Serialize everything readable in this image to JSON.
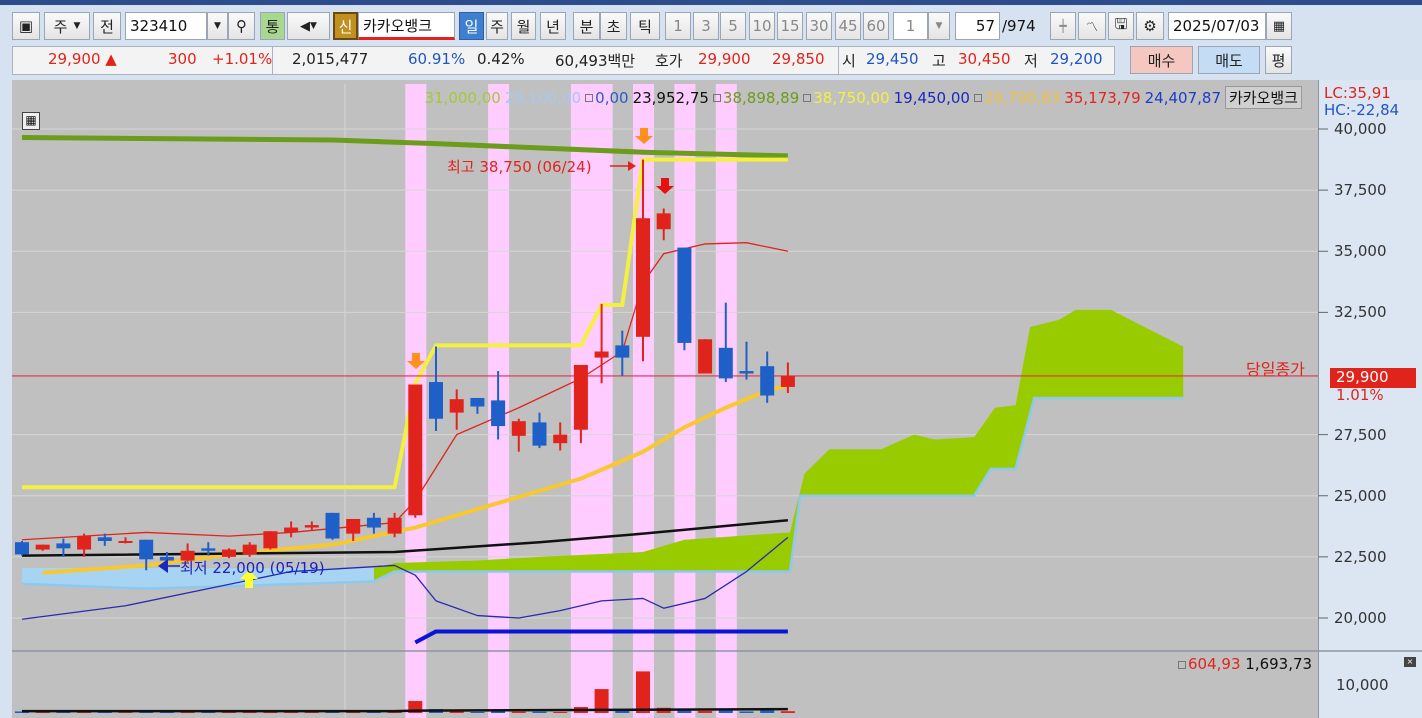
{
  "toolbar": {
    "market_label": "주",
    "prev_label": "전",
    "code": "323410",
    "comm_label": "통",
    "credit_label": "신",
    "stock_name": "카카오뱅크",
    "periods": [
      "일",
      "주",
      "월",
      "년",
      "분",
      "초",
      "틱"
    ],
    "selected_period": "일",
    "intervals": [
      "1",
      "3",
      "5",
      "10",
      "15",
      "30",
      "45",
      "60"
    ],
    "unit_value": "1",
    "count_value": "57",
    "count_total": "/974",
    "date": "2025/07/03"
  },
  "quote": {
    "price": "29,900",
    "change_arrow": "▲",
    "change": "300",
    "change_pct": "+1.01%",
    "volume": "2,015,477",
    "ratio1": "60.91%",
    "ratio2": "0.42%",
    "amount": "60,493백만",
    "hoga_label": "호가",
    "ask": "29,900",
    "bid": "29,850",
    "open_label": "시",
    "open": "29,450",
    "high_label": "고",
    "high": "30,450",
    "low_label": "저",
    "low": "29,200",
    "buy_label": "매수",
    "sell_label": "매도",
    "eval_label": "평"
  },
  "legend": {
    "items": [
      {
        "text": "31,000,00",
        "color": "#a4c83c",
        "box": false
      },
      {
        "text": "29,100,00",
        "color": "#a8c8ec",
        "box": false
      },
      {
        "text": "0,00",
        "color": "#2a5ad0",
        "box": true
      },
      {
        "text": "23,952,75",
        "color": "#111111",
        "box": false
      },
      {
        "text": "38,898,89",
        "color": "#6c9c1c",
        "box": true
      },
      {
        "text": "38,750,00",
        "color": "#f4f040",
        "box": true
      },
      {
        "text": "19,450,00",
        "color": "#1a28c0",
        "box": false
      },
      {
        "text": "29,790,83",
        "color": "#f0c040",
        "box": true
      },
      {
        "text": "35,173,79",
        "color": "#e0241c",
        "box": false
      },
      {
        "text": "24,407,87",
        "color": "#1a3cc8",
        "box": false
      }
    ],
    "stock_name": "카카오뱅크",
    "lc": "LC:35,91",
    "hc": "HC:-22,84"
  },
  "axis": {
    "ticks": [
      "40,000",
      "37,500",
      "35,000",
      "32,500",
      "27,500",
      "25,000",
      "22,500",
      "20,000"
    ],
    "tick_values": [
      40000,
      37500,
      35000,
      32500,
      27500,
      25000,
      22500,
      20000
    ],
    "close_label": "당일종가",
    "close_price": "29,900",
    "close_value": 29900,
    "close_pct": "1.01%",
    "volume_tick": "10,000",
    "volume_tick_value": 10000
  },
  "annotations": {
    "high": "최고 38,750 (06/24)",
    "low": "최저 22,000 (05/19)"
  },
  "volume_legend": {
    "v1": "604,93",
    "v2": "1,693,73"
  },
  "colors": {
    "up": "#e0241c",
    "down": "#1f5fc8",
    "highlight": "#ffccff"
  },
  "chart_data": {
    "type": "candlestick",
    "ylim": [
      19000,
      41000
    ],
    "highlight_indices": [
      19,
      23,
      27,
      28,
      30,
      32,
      34
    ],
    "candles": [
      [
        23100,
        23150,
        22550,
        22600
      ],
      [
        22800,
        23000,
        22750,
        23000
      ],
      [
        23050,
        23250,
        22500,
        22850
      ],
      [
        22800,
        23450,
        22500,
        23350
      ],
      [
        23300,
        23450,
        22950,
        23150
      ],
      [
        23100,
        23300,
        23050,
        23150
      ],
      [
        23200,
        23200,
        21950,
        22400
      ],
      [
        22500,
        22700,
        22050,
        22350
      ],
      [
        22350,
        23050,
        22300,
        22750
      ],
      [
        22850,
        23100,
        22550,
        22750
      ],
      [
        22500,
        22850,
        22450,
        22800
      ],
      [
        22600,
        23100,
        22500,
        23000
      ],
      [
        22850,
        23550,
        22800,
        23550
      ],
      [
        23500,
        23950,
        23300,
        23700
      ],
      [
        23700,
        23950,
        23600,
        23800
      ],
      [
        24300,
        24300,
        23200,
        23250
      ],
      [
        23450,
        24050,
        23150,
        24050
      ],
      [
        24100,
        24300,
        23450,
        23700
      ],
      [
        23450,
        24300,
        23300,
        24100
      ],
      [
        24200,
        29550,
        24100,
        29550
      ],
      [
        29650,
        31100,
        27650,
        28150
      ],
      [
        28400,
        29350,
        27700,
        28950
      ],
      [
        29000,
        29000,
        28350,
        28650
      ],
      [
        28900,
        30100,
        27300,
        27850
      ],
      [
        27450,
        28150,
        26800,
        28050
      ],
      [
        28000,
        28400,
        26950,
        27050
      ],
      [
        27150,
        28000,
        26850,
        27500
      ],
      [
        27700,
        30350,
        27150,
        30350
      ],
      [
        30650,
        32850,
        29600,
        30900
      ],
      [
        31150,
        31750,
        29900,
        30650
      ],
      [
        31500,
        38750,
        30500,
        36350
      ],
      [
        35900,
        36750,
        35450,
        36550
      ],
      [
        35150,
        35150,
        30950,
        31250
      ],
      [
        30000,
        31400,
        30000,
        31400
      ],
      [
        31050,
        32900,
        29650,
        29800
      ],
      [
        30100,
        31300,
        29750,
        30000
      ],
      [
        30300,
        30900,
        28800,
        29100
      ],
      [
        29450,
        30450,
        29200,
        29900
      ]
    ],
    "lines": [
      {
        "name": "envelope-top",
        "color": "#6c9c1c",
        "width": 5,
        "points": [
          [
            0,
            39650
          ],
          [
            15,
            39550
          ],
          [
            20,
            39400
          ],
          [
            30,
            39050
          ],
          [
            37,
            38900
          ]
        ]
      },
      {
        "name": "price-channel",
        "color": "#f4f040",
        "width": 4,
        "points": [
          [
            0,
            25350
          ],
          [
            18,
            25350
          ],
          [
            19,
            29600
          ],
          [
            20,
            31150
          ],
          [
            27,
            31150
          ],
          [
            28,
            32800
          ],
          [
            29,
            32800
          ],
          [
            30,
            38750
          ],
          [
            37,
            38750
          ]
        ]
      },
      {
        "name": "ma-long",
        "color": "#f8c830",
        "width": 4,
        "points": [
          [
            1,
            21850
          ],
          [
            6,
            22150
          ],
          [
            10,
            22600
          ],
          [
            15,
            23000
          ],
          [
            19,
            23700
          ],
          [
            23,
            24700
          ],
          [
            27,
            25700
          ],
          [
            30,
            26800
          ],
          [
            32,
            27800
          ],
          [
            34,
            28600
          ],
          [
            36,
            29300
          ],
          [
            37,
            29500
          ]
        ]
      },
      {
        "name": "ma-short",
        "color": "#e0241c",
        "width": 1.3,
        "points": [
          [
            0,
            23200
          ],
          [
            6,
            23500
          ],
          [
            10,
            23350
          ],
          [
            13,
            23500
          ],
          [
            18,
            23900
          ],
          [
            19,
            24800
          ],
          [
            21,
            27500
          ],
          [
            24,
            28600
          ],
          [
            27,
            29800
          ],
          [
            29,
            30900
          ],
          [
            30,
            33700
          ],
          [
            31,
            34900
          ],
          [
            33,
            35300
          ],
          [
            35,
            35350
          ],
          [
            37,
            35000
          ]
        ]
      },
      {
        "name": "ma-black",
        "color": "#111111",
        "width": 2.5,
        "points": [
          [
            0,
            22550
          ],
          [
            18,
            22700
          ],
          [
            25,
            23100
          ],
          [
            30,
            23450
          ],
          [
            37,
            24000
          ]
        ]
      },
      {
        "name": "blue-thin",
        "color": "#2a2ab0",
        "width": 1.3,
        "points": [
          [
            0,
            19950
          ],
          [
            5,
            20500
          ],
          [
            9,
            21200
          ],
          [
            13,
            21900
          ],
          [
            18,
            22150
          ],
          [
            19,
            21750
          ],
          [
            20,
            20700
          ],
          [
            22,
            20100
          ],
          [
            24,
            20000
          ],
          [
            26,
            20300
          ],
          [
            28,
            20700
          ],
          [
            30,
            20800
          ],
          [
            31,
            20400
          ],
          [
            33,
            20800
          ],
          [
            35,
            21900
          ],
          [
            37,
            23300
          ]
        ]
      },
      {
        "name": "envelope-bottom",
        "color": "#0a14d8",
        "width": 4,
        "points": [
          [
            19,
            19000
          ],
          [
            20,
            19450
          ],
          [
            37,
            19450
          ]
        ]
      }
    ],
    "cloud": {
      "upper": [
        [
          0,
          22050
        ],
        [
          17,
          22050
        ],
        [
          18,
          22250
        ],
        [
          22,
          22350
        ],
        [
          25,
          22500
        ],
        [
          30,
          22700
        ],
        [
          32,
          23200
        ],
        [
          37.1,
          23500
        ],
        [
          37.8,
          25900
        ],
        [
          39,
          26900
        ],
        [
          41.5,
          26900
        ],
        [
          43.1,
          27500
        ],
        [
          44.1,
          27300
        ],
        [
          46,
          27400
        ],
        [
          47,
          28600
        ],
        [
          48,
          28700
        ],
        [
          48.7,
          31900
        ],
        [
          50.1,
          32200
        ],
        [
          50.9,
          32600
        ],
        [
          52.6,
          32600
        ],
        [
          56.1,
          31100
        ]
      ],
      "lower": [
        [
          0,
          21400
        ],
        [
          6,
          21200
        ],
        [
          10,
          21300
        ],
        [
          17,
          21500
        ],
        [
          18,
          21900
        ],
        [
          37.1,
          21900
        ],
        [
          37.6,
          25000
        ],
        [
          46,
          25000
        ],
        [
          46.8,
          26100
        ],
        [
          48,
          26100
        ],
        [
          48.9,
          29000
        ],
        [
          56.1,
          29000
        ]
      ]
    },
    "volumes": [
      600,
      500,
      500,
      700,
      400,
      300,
      900,
      500,
      600,
      400,
      500,
      600,
      800,
      600,
      400,
      900,
      700,
      600,
      800,
      4600,
      1500,
      600,
      400,
      1000,
      500,
      500,
      400,
      2300,
      9200,
      1500,
      16000,
      2000,
      1500,
      800,
      1200,
      600,
      1000,
      700
    ],
    "volume_ma": [
      [
        0,
        700
      ],
      [
        18,
        700
      ],
      [
        19,
        900
      ],
      [
        37,
        1500
      ]
    ]
  }
}
